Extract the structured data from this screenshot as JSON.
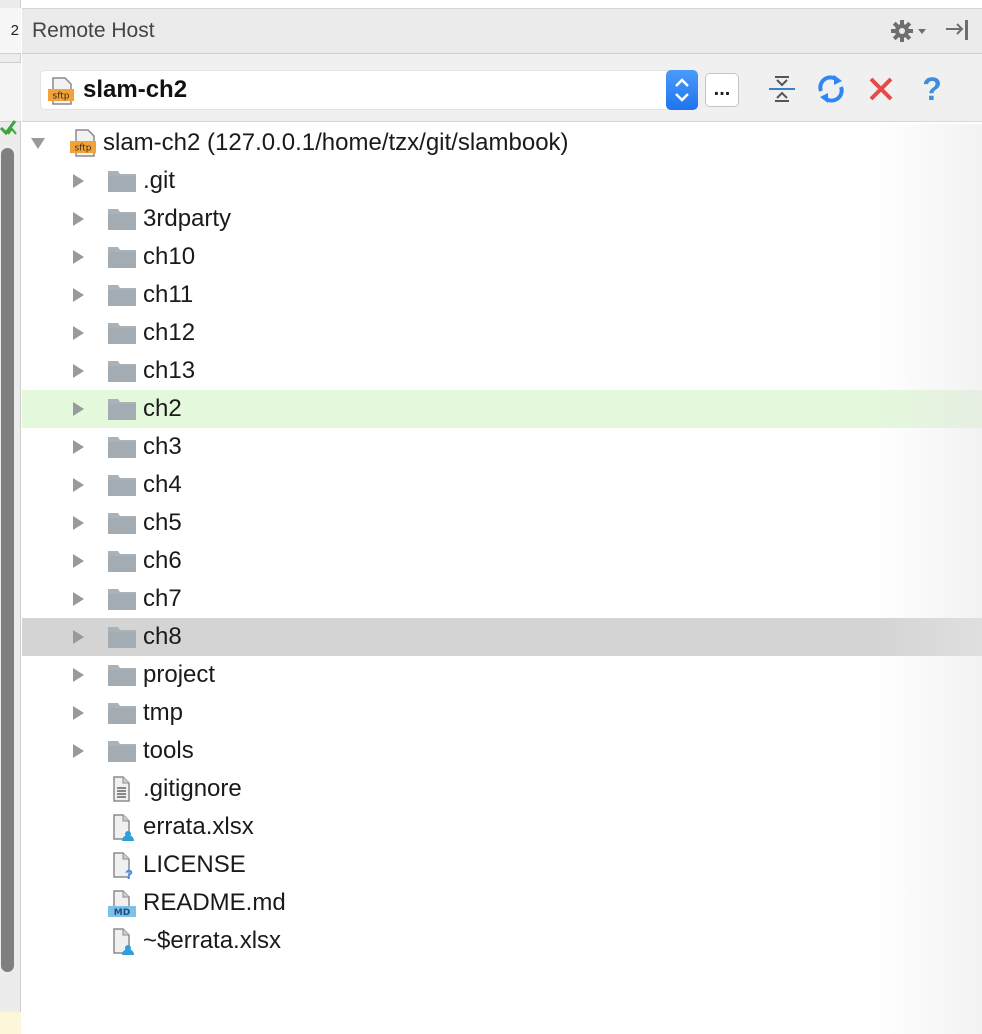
{
  "left_tab_label": "2",
  "window": {
    "title": "Remote Host"
  },
  "toolbar": {
    "server_select": {
      "value": "slam-ch2",
      "icon": "sftp-icon"
    },
    "more_button_label": "...",
    "buttons": [
      "collapse-all-icon",
      "refresh-icon",
      "delete-icon",
      "help-icon"
    ]
  },
  "tree": {
    "root": {
      "label": "slam-ch2 (127.0.0.1/home/tzx/git/slambook)",
      "expanded": true,
      "icon": "sftp-icon"
    },
    "children": [
      {
        "label": ".git",
        "type": "folder"
      },
      {
        "label": "3rdparty",
        "type": "folder"
      },
      {
        "label": "ch10",
        "type": "folder"
      },
      {
        "label": "ch11",
        "type": "folder"
      },
      {
        "label": "ch12",
        "type": "folder"
      },
      {
        "label": "ch13",
        "type": "folder"
      },
      {
        "label": "ch2",
        "type": "folder",
        "highlight": "green"
      },
      {
        "label": "ch3",
        "type": "folder"
      },
      {
        "label": "ch4",
        "type": "folder"
      },
      {
        "label": "ch5",
        "type": "folder"
      },
      {
        "label": "ch6",
        "type": "folder"
      },
      {
        "label": "ch7",
        "type": "folder"
      },
      {
        "label": "ch8",
        "type": "folder",
        "highlight": "selected"
      },
      {
        "label": "project",
        "type": "folder"
      },
      {
        "label": "tmp",
        "type": "folder"
      },
      {
        "label": "tools",
        "type": "folder"
      },
      {
        "label": ".gitignore",
        "type": "text-file"
      },
      {
        "label": "errata.xlsx",
        "type": "user-file"
      },
      {
        "label": "LICENSE",
        "type": "unknown-file"
      },
      {
        "label": "README.md",
        "type": "md-file",
        "badge": "MD"
      },
      {
        "label": "~$errata.xlsx",
        "type": "user-file"
      }
    ]
  },
  "colors": {
    "folder": "#a9b2b8",
    "green_highlight": "#e4f8dc",
    "selected_row": "#d4d4d4",
    "accent_blue": "#2f86f6",
    "delete_red": "#e84a4a",
    "help_blue": "#3d8fd9"
  }
}
